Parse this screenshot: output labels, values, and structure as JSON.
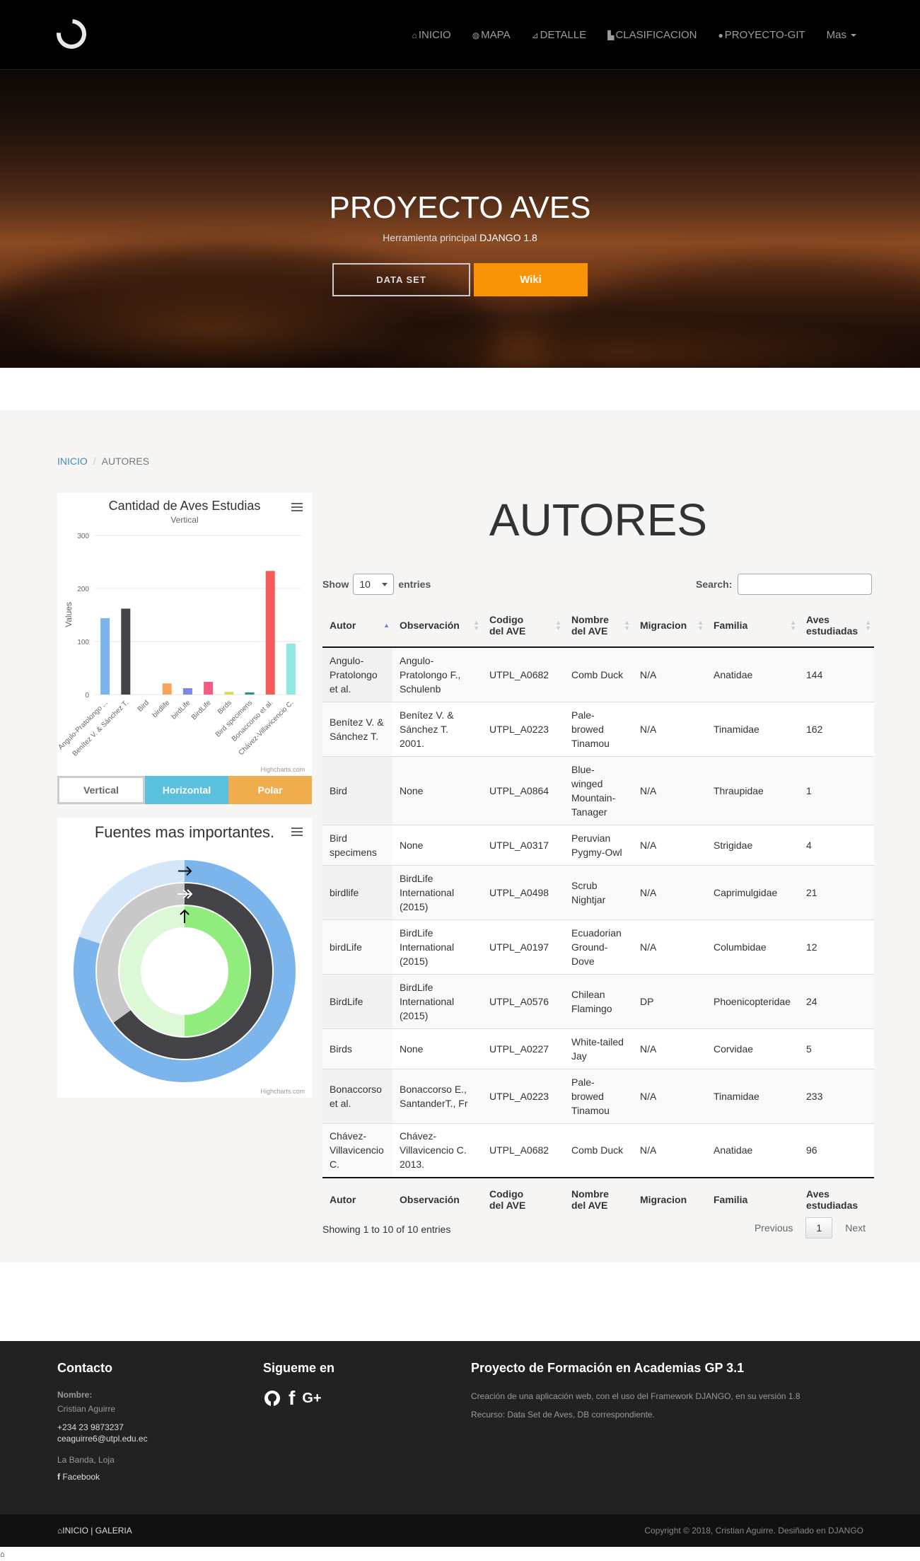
{
  "navbar": {
    "items": [
      {
        "label": "INICIO",
        "icon": "home-icon"
      },
      {
        "label": "MAPA",
        "icon": "globe-icon"
      },
      {
        "label": "DETALLE",
        "icon": "line-chart-icon"
      },
      {
        "label": "CLASIFICACION",
        "icon": "industry-icon"
      },
      {
        "label": "PROYECTO-GIT",
        "icon": "github-icon"
      },
      {
        "label": "Mas",
        "icon": "caret-down-icon"
      }
    ]
  },
  "hero": {
    "title": "PROYECTO AVES",
    "subtitle_prefix": "Herramienta principal",
    "subtitle_highlight": "DJANGO 1.8",
    "btn_dataset": "DATA SET",
    "btn_wiki": "Wiki"
  },
  "breadcrumb": {
    "home": "INICIO",
    "current": "AUTORES"
  },
  "chart1": {
    "menu_icon": "hamburger-menu-icon",
    "credit": "Highcharts.com",
    "buttons": {
      "vertical": "Vertical",
      "horizontal": "Horizontal",
      "polar": "Polar"
    }
  },
  "chart_data": [
    {
      "type": "bar",
      "title": "Cantidad de Aves Estudias",
      "subtitle": "Vertical",
      "ylabel": "Values",
      "ylim": [
        0,
        300
      ],
      "yticks": [
        0,
        100,
        200,
        300
      ],
      "grid": true,
      "categories": [
        "Angulo-Pratolongo ...",
        "Benítez V. & Sánchez T.",
        "Bird",
        "birdlife",
        "birdLife",
        "BirdLife",
        "Birds",
        "Bird specimens",
        "Bonaccorso et al.",
        "Chávez-Villavicencio C."
      ],
      "values": [
        144,
        162,
        0,
        21,
        12,
        24,
        5,
        4,
        233,
        96
      ],
      "colors": [
        "#7cb5ec",
        "#434348",
        "#90ed7d",
        "#f7a35c",
        "#8085e9",
        "#f15c80",
        "#e4d354",
        "#2b908f",
        "#f45b5b",
        "#91e8e1"
      ]
    },
    {
      "type": "activity-gauge",
      "title": "Fuentes mas importantes.",
      "series": [
        {
          "value": 80,
          "color": "#7cb5ec",
          "icon": "arrow-right-icon"
        },
        {
          "value": 65,
          "color": "#434348",
          "icon": "double-arrow-right-icon"
        },
        {
          "value": 50,
          "color": "#90ed7d",
          "icon": "arrow-up-icon"
        }
      ]
    }
  ],
  "chart2": {
    "menu_icon": "hamburger-menu-icon",
    "credit": "Highcharts.com"
  },
  "table_section": {
    "title": "AUTORES",
    "show_label": "Show",
    "entries_value": "10",
    "entries_label": "entries",
    "search_label": "Search:",
    "search_value": "",
    "columns": [
      {
        "l1": "Autor",
        "l2": ""
      },
      {
        "l1": "Observación",
        "l2": ""
      },
      {
        "l1": "Codigo",
        "l2": "del AVE"
      },
      {
        "l1": "Nombre",
        "l2": "del AVE"
      },
      {
        "l1": "Migracion",
        "l2": ""
      },
      {
        "l1": "Familia",
        "l2": ""
      },
      {
        "l1": "Aves",
        "l2": "estudiadas"
      }
    ],
    "rows": [
      [
        "Angulo-Pratolongo et al.",
        "Angulo-Pratolongo F., Schulenb",
        "UTPL_A0682",
        "Comb Duck",
        "N/A",
        "Anatidae",
        "144"
      ],
      [
        "Benítez V. & Sánchez T.",
        "Benítez V. & Sánchez T. 2001.",
        "UTPL_A0223",
        "Pale-browed Tinamou",
        "N/A",
        "Tinamidae",
        "162"
      ],
      [
        "Bird",
        "None",
        "UTPL_A0864",
        "Blue-winged Mountain-Tanager",
        "N/A",
        "Thraupidae",
        "1"
      ],
      [
        "Bird specimens",
        "None",
        "UTPL_A0317",
        "Peruvian Pygmy-Owl",
        "N/A",
        "Strigidae",
        "4"
      ],
      [
        "birdlife",
        "BirdLife International (2015)",
        "UTPL_A0498",
        "Scrub Nightjar",
        "N/A",
        "Caprimulgidae",
        "21"
      ],
      [
        "birdLife",
        "BirdLife International (2015)",
        "UTPL_A0197",
        "Ecuadorian Ground-Dove",
        "N/A",
        "Columbidae",
        "12"
      ],
      [
        "BirdLife",
        "BirdLife International (2015)",
        "UTPL_A0576",
        "Chilean Flamingo",
        "DP",
        "Phoenicopteridae",
        "24"
      ],
      [
        "Birds",
        "None",
        "UTPL_A0227",
        "White-tailed Jay",
        "N/A",
        "Corvidae",
        "5"
      ],
      [
        "Bonaccorso et al.",
        "Bonaccorso E., SantanderT., Fr",
        "UTPL_A0223",
        "Pale-browed Tinamou",
        "N/A",
        "Tinamidae",
        "233"
      ],
      [
        "Chávez-Villavicencio C.",
        "Chávez-Villavicencio C. 2013.",
        "UTPL_A0682",
        "Comb Duck",
        "N/A",
        "Anatidae",
        "96"
      ]
    ],
    "info": "Showing 1 to 10 of 10 entries",
    "prev": "Previous",
    "page": "1",
    "next": "Next"
  },
  "footer": {
    "contact_title": "Contacto",
    "name_label": "Nombre:",
    "name": "Cristian Aguirre",
    "phone": "+234 23 9873237",
    "email": "ceaguirre6@utpl.edu.ec",
    "location": "La Banda, Loja",
    "facebook": "Facebook",
    "follow_title": "Sigueme en",
    "project_title": "Proyecto de Formación en Academias GP 3.1",
    "project_desc": "Creación de una aplicación web, con el uso del Framework DJANGO, en su versión 1.8",
    "project_res": "Recurso: Data Set de Aves, DB correspondiente.",
    "bar_inicio": "INICIO",
    "bar_sep": "|",
    "bar_galeria": "GALERIA",
    "copyright": "Copyright © 2018, Cristian Aguirre. Desiñado en DJANGO"
  }
}
